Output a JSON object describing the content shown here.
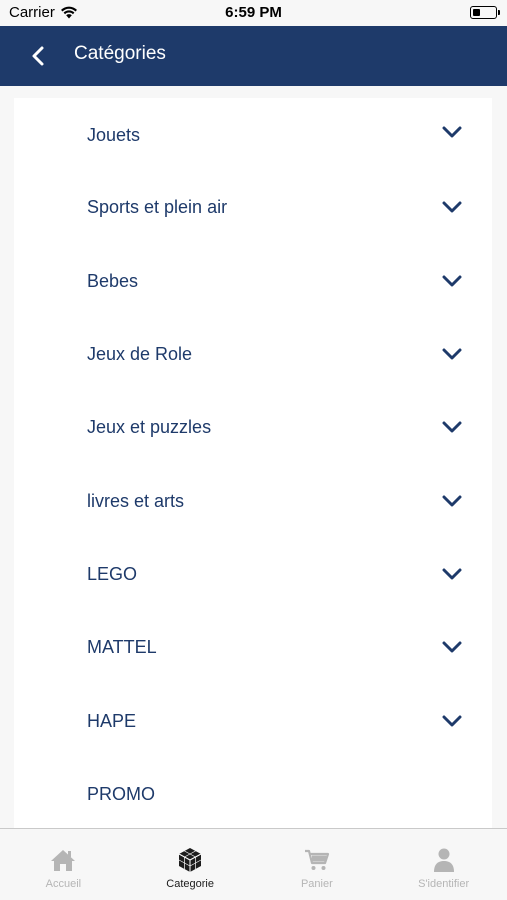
{
  "status_bar": {
    "carrier": "Carrier",
    "time": "6:59 PM"
  },
  "nav": {
    "title": "Catégories"
  },
  "categories": [
    {
      "label": "Jouets",
      "expandable": true
    },
    {
      "label": "Sports et plein air",
      "expandable": true
    },
    {
      "label": "Bebes",
      "expandable": true
    },
    {
      "label": "Jeux de Role",
      "expandable": true
    },
    {
      "label": "Jeux et puzzles",
      "expandable": true
    },
    {
      "label": "livres et arts",
      "expandable": true
    },
    {
      "label": "LEGO",
      "expandable": true
    },
    {
      "label": "MATTEL",
      "expandable": true
    },
    {
      "label": "HAPE",
      "expandable": true
    },
    {
      "label": "PROMO",
      "expandable": false
    }
  ],
  "tabs": [
    {
      "label": "Accueil",
      "icon": "home-icon",
      "active": false
    },
    {
      "label": "Categorie",
      "icon": "cube-icon",
      "active": true
    },
    {
      "label": "Panier",
      "icon": "cart-icon",
      "active": false
    },
    {
      "label": "S'identifier",
      "icon": "user-icon",
      "active": false
    }
  ],
  "colors": {
    "primary": "#1e3a6a",
    "background": "#f7f7f7",
    "tab_inactive": "#b5b5b5",
    "tab_active": "#1c1c1c"
  }
}
